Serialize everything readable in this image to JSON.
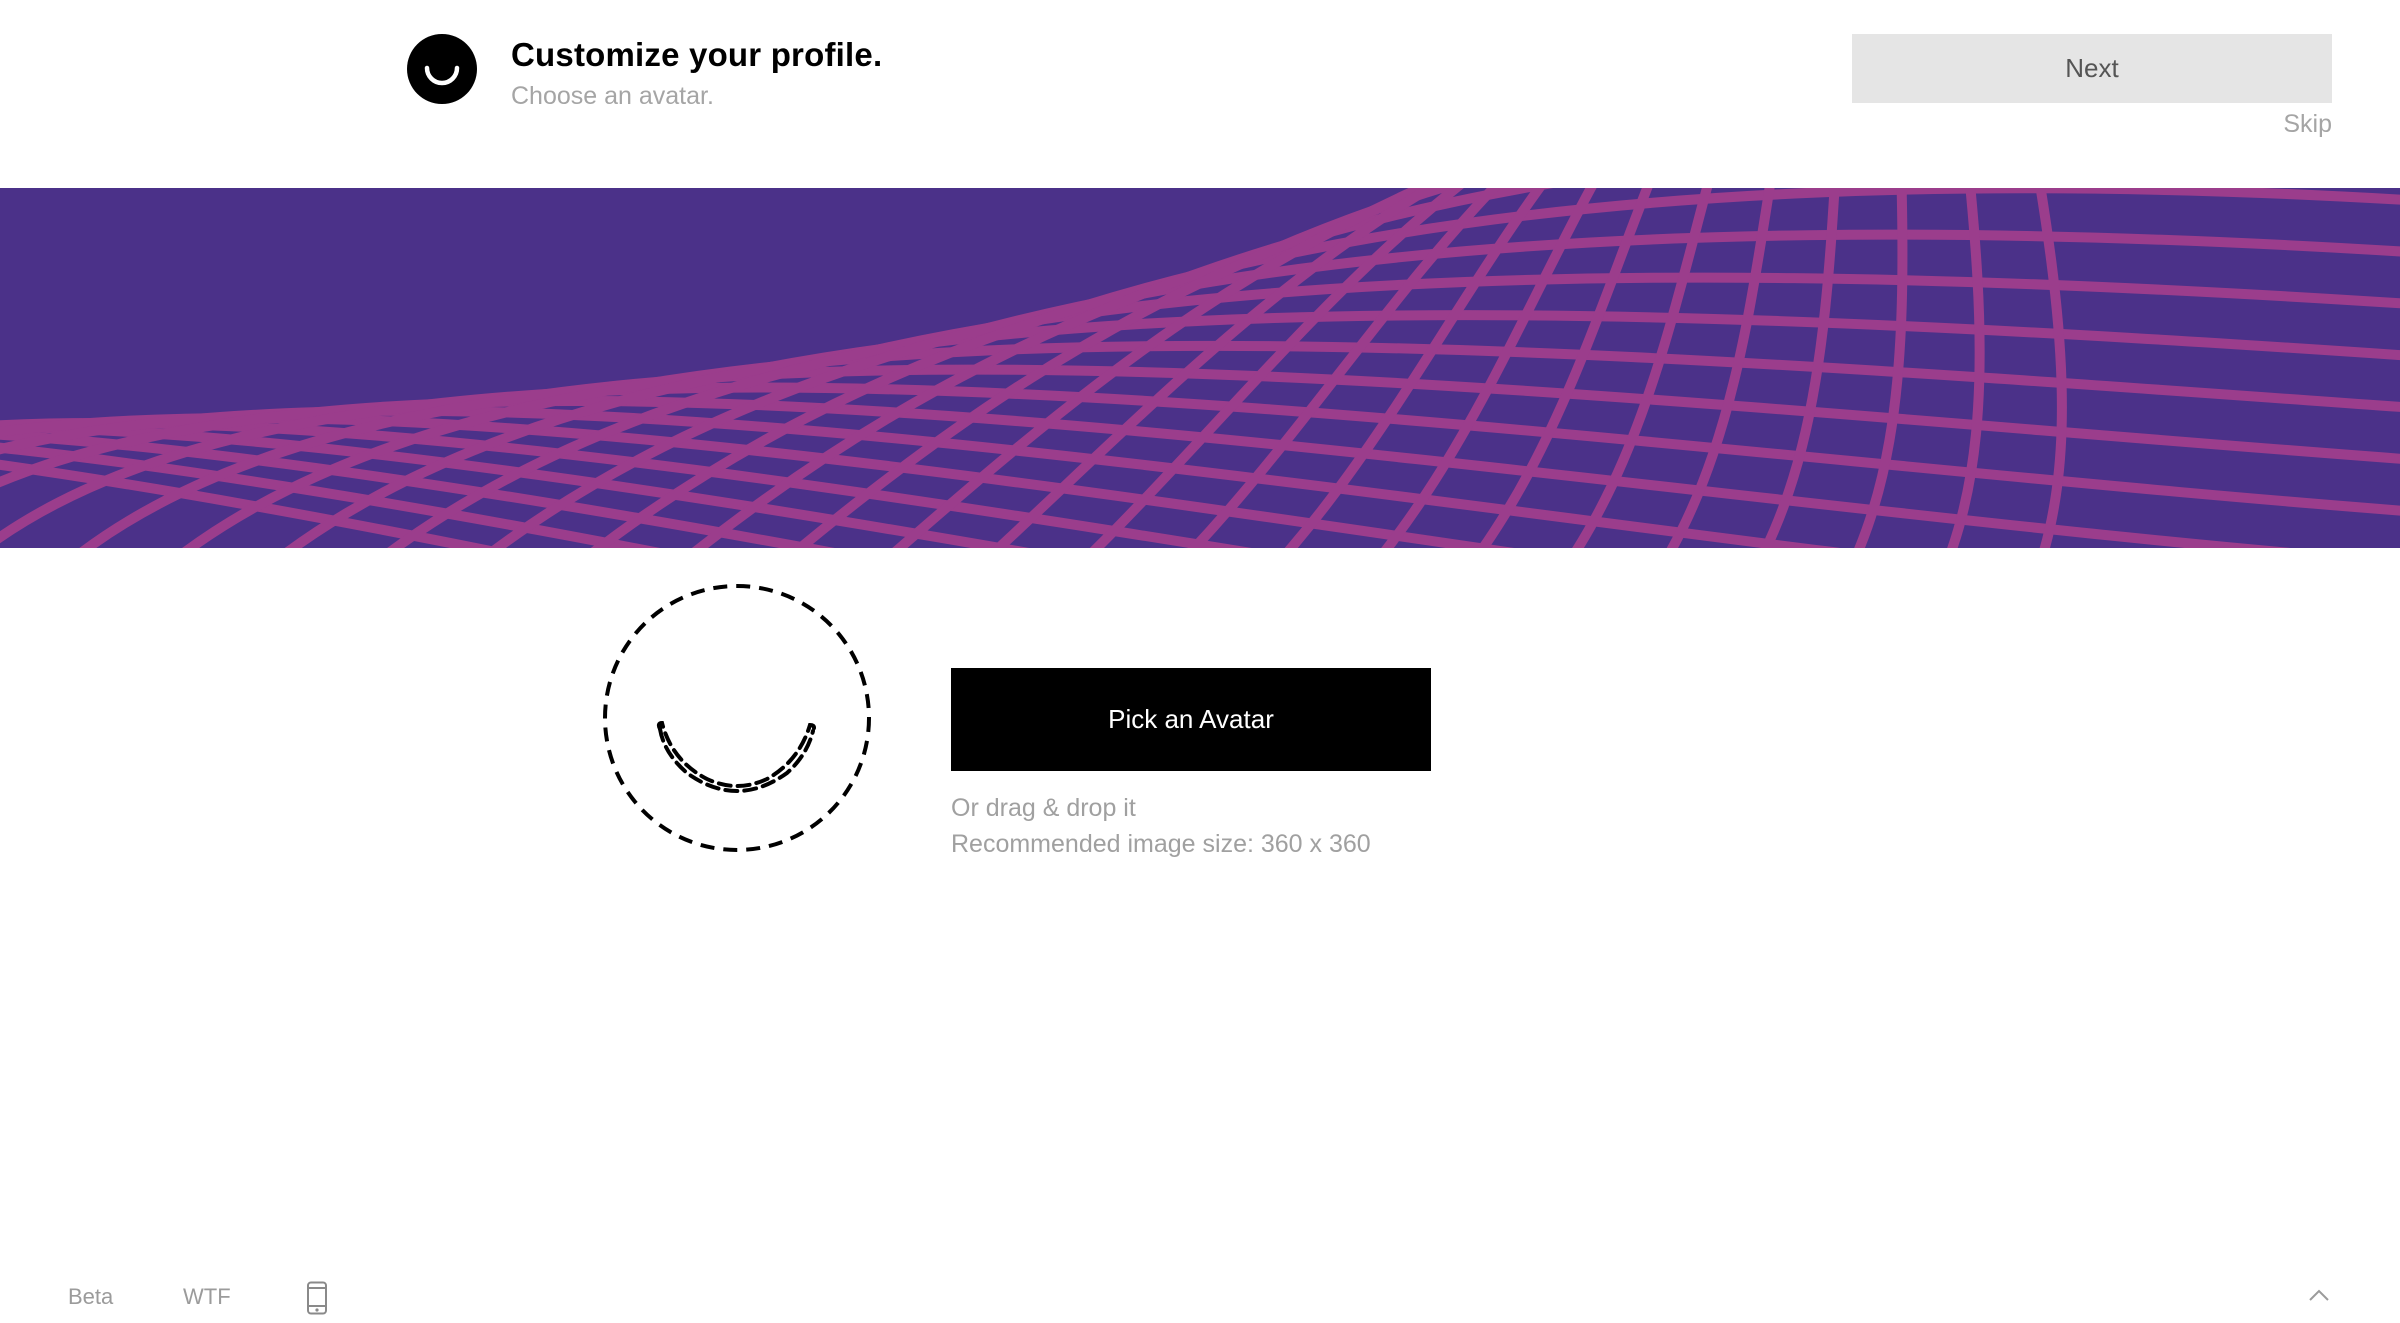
{
  "header": {
    "title": "Customize your profile.",
    "subtitle": "Choose an avatar.",
    "next_label": "Next",
    "skip_label": "Skip",
    "logo_icon": "smiley-logo-icon"
  },
  "banner": {
    "colors": {
      "background": "#4b3189",
      "stripe": "#9b3d8c"
    }
  },
  "avatar": {
    "placeholder_icon": "dashed-smiley-icon",
    "pick_label": "Pick an Avatar",
    "hint_drag": "Or drag & drop it",
    "hint_size": "Recommended image size: 360 x 360"
  },
  "footer": {
    "beta_label": "Beta",
    "wtf_label": "WTF",
    "phone_icon": "mobile-phone-icon",
    "scroll_top_icon": "chevron-up-icon"
  }
}
